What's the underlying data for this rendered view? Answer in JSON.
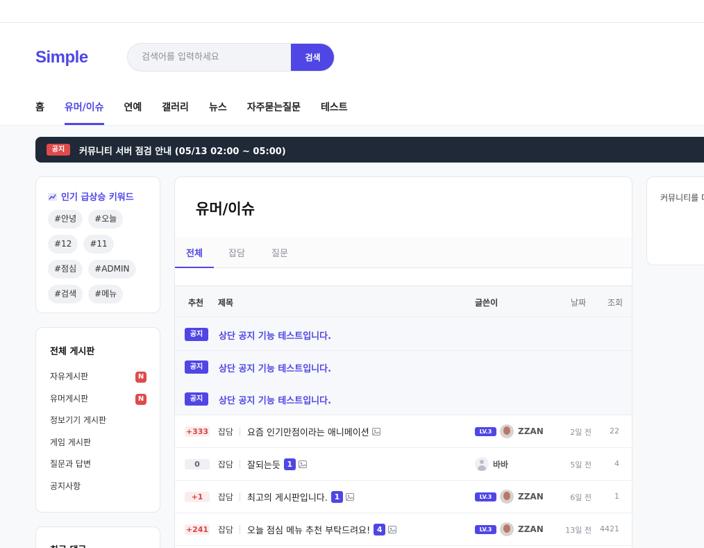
{
  "header": {
    "logo": "Simple",
    "search_placeholder": "검색어를 입력하세요",
    "search_button": "검색",
    "nav": [
      "홈",
      "유머/이슈",
      "연예",
      "갤러리",
      "뉴스",
      "자주묻는질문",
      "테스트"
    ],
    "nav_active": "유머/이슈"
  },
  "notice_bar": {
    "badge": "공지",
    "text": "커뮤니티 서버 점검 안내 (05/13 02:00 ~ 05:00)"
  },
  "keywords": {
    "title": "인기 급상승 키워드",
    "tags": [
      "#안녕",
      "#오늘",
      "#12",
      "#11",
      "#점심",
      "#ADMIN",
      "#검색",
      "#메뉴"
    ]
  },
  "boards": {
    "title": "전체 게시판",
    "items": [
      {
        "label": "자유게시판",
        "badge": "N"
      },
      {
        "label": "유머게시판",
        "badge": "N"
      },
      {
        "label": "정보기기 게시판",
        "badge": ""
      },
      {
        "label": "게임 게시판",
        "badge": ""
      },
      {
        "label": "질문과 답변",
        "badge": ""
      },
      {
        "label": "공지사항",
        "badge": ""
      }
    ]
  },
  "recent_comments": {
    "title": "최근 댓글"
  },
  "main": {
    "title": "유머/이슈",
    "tabs": [
      "전체",
      "잡담",
      "질문"
    ],
    "active_tab": "전체",
    "columns": {
      "recommend": "추천",
      "title": "제목",
      "author": "글쓴이",
      "date": "날짜",
      "views": "조회"
    },
    "notices": [
      {
        "tag": "공지",
        "title": "상단 공지 기능 테스트입니다."
      },
      {
        "tag": "공지",
        "title": "상단 공지 기능 테스트입니다."
      },
      {
        "tag": "공지",
        "title": "상단 공지 기능 테스트입니다."
      }
    ],
    "posts": [
      {
        "recommend": "+333",
        "category": "잡담",
        "title": "요즘 인기만점이라는 애니메이션",
        "comments": "",
        "level": "LV.3",
        "author": "ZZAN",
        "date": "2일 전",
        "views": "22"
      },
      {
        "recommend": "0",
        "category": "잡담",
        "title": "잘되는듯",
        "comments": "1",
        "level": "",
        "author": "바바",
        "date": "5일 전",
        "views": "4"
      },
      {
        "recommend": "+1",
        "category": "잡담",
        "title": "최고의 게시판입니다.",
        "comments": "1",
        "level": "LV.3",
        "author": "ZZAN",
        "date": "6일 전",
        "views": "1"
      },
      {
        "recommend": "+241",
        "category": "잡담",
        "title": "오늘 점심 메뉴 추천 부탁드려요!",
        "comments": "4",
        "level": "LV.3",
        "author": "ZZAN",
        "date": "13일 전",
        "views": "4421"
      }
    ]
  },
  "right_panel": {
    "text": "커뮤니티를 더"
  },
  "colors": {
    "accent": "#4f46e5",
    "notice_bar_bg": "#1f2937",
    "alert_red": "#e04a4a"
  }
}
